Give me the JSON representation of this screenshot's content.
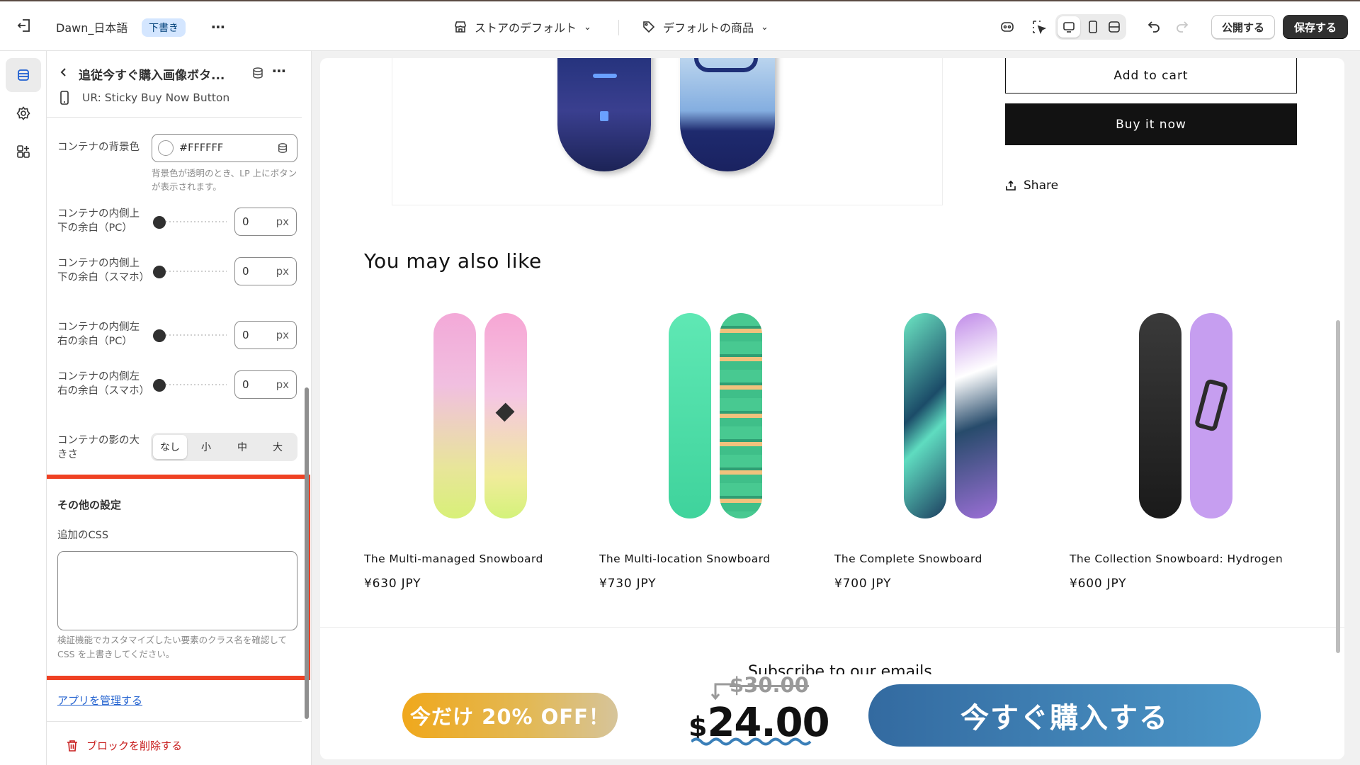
{
  "topbar": {
    "theme_name": "Dawn_日本語",
    "draft_badge": "下書き",
    "store_default": "ストアのデフォルト",
    "product_default": "デフォルトの商品",
    "publish": "公開する",
    "save": "保存する"
  },
  "panel": {
    "title": "追従今すぐ購入画像ボタ...",
    "subtitle": "UR: Sticky Buy Now Button",
    "bg_color_label": "コンテナの背景色",
    "bg_color_value": "#FFFFFF",
    "bg_color_help": "背景色が透明のとき、LP 上にボタンが表示されます。",
    "padding_rows": [
      {
        "label": "コンテナの内側上下の余白（PC）",
        "value": "0",
        "unit": "px"
      },
      {
        "label": "コンテナの内側上下の余白（スマホ）",
        "value": "0",
        "unit": "px"
      },
      {
        "label": "コンテナの内側左右の余白（PC）",
        "value": "0",
        "unit": "px"
      },
      {
        "label": "コンテナの内側左右の余白（スマホ）",
        "value": "0",
        "unit": "px"
      }
    ],
    "shadow_label": "コンテナの影の大きさ",
    "shadow_options": [
      "なし",
      "小",
      "中",
      "大"
    ],
    "shadow_selected": "なし",
    "other_settings_title": "その他の設定",
    "css_label": "追加のCSS",
    "css_value": "",
    "css_help": "検証機能でカスタマイズしたい要素のクラス名を確認して CSS を上書きしてください。",
    "manage_apps": "アプリを管理する",
    "delete_block": "ブロックを削除する"
  },
  "preview": {
    "add_to_cart": "Add to cart",
    "buy_now": "Buy it now",
    "share": "Share",
    "section_title": "You may also like",
    "products": [
      {
        "name": "The Multi-managed Snowboard",
        "price": "¥630 JPY"
      },
      {
        "name": "The Multi-location Snowboard",
        "price": "¥730 JPY"
      },
      {
        "name": "The Complete Snowboard",
        "price": "¥700 JPY"
      },
      {
        "name": "The Collection Snowboard: Hydrogen",
        "price": "¥600 JPY"
      }
    ],
    "subscribe_heading": "Subscribe to our emails",
    "sticky": {
      "discount": "今だけ 20% OFF！",
      "old_price": "$30.00",
      "currency": "$",
      "new_price": "24.00",
      "cta": "今すぐ購入する"
    }
  },
  "colors": {
    "accent_red": "#ef4123",
    "dark": "#303030",
    "link": "#2463d0"
  }
}
